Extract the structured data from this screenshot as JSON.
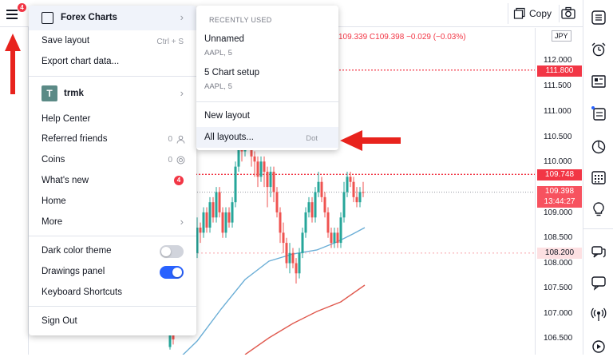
{
  "topbar": {
    "menu_badge": "4",
    "copy_label": "Copy"
  },
  "chart": {
    "ohlc_text": "109.339 C109.398 −0.029 (−0.03%)",
    "currency": "JPY",
    "price_ticks": [
      "112.000",
      "111.500",
      "111.000",
      "110.500",
      "110.000",
      "109.000",
      "108.500",
      "108.000",
      "107.500",
      "107.000",
      "106.500"
    ],
    "price_labels": {
      "high_line": "111.800",
      "mid_line": "109.748",
      "current": "109.398",
      "countdown": "13:44:27",
      "low_line": "108.200"
    },
    "colors": {
      "up": "#26a69a",
      "down": "#ef5350",
      "ma_fast": "#6baed6",
      "ma_slow": "#e05a4f",
      "price_line": "#f23645"
    }
  },
  "main_menu": {
    "layout_name": "Forex Charts",
    "items": {
      "save_layout": "Save layout",
      "save_shortcut": "Ctrl + S",
      "export_data": "Export chart data...",
      "user_initial": "T",
      "user_name": "trmk",
      "help_center": "Help Center",
      "referred_friends": "Referred friends",
      "referred_count": "0",
      "coins": "Coins",
      "coins_count": "0",
      "whats_new": "What's new",
      "whats_new_badge": "4",
      "home": "Home",
      "more": "More",
      "dark_theme": "Dark color theme",
      "drawings_panel": "Drawings panel",
      "keyboard_shortcuts": "Keyboard Shortcuts",
      "sign_out": "Sign Out"
    },
    "toggles": {
      "dark_theme_on": false,
      "drawings_panel_on": true
    }
  },
  "sub_menu": {
    "heading": "RECENTLY USED",
    "recent": [
      {
        "title": "Unnamed",
        "subtitle": "AAPL, 5"
      },
      {
        "title": "5 Chart setup",
        "subtitle": "AAPL, 5"
      }
    ],
    "new_layout": "New layout",
    "all_layouts": "All layouts...",
    "all_layouts_shortcut": "Dot"
  }
}
